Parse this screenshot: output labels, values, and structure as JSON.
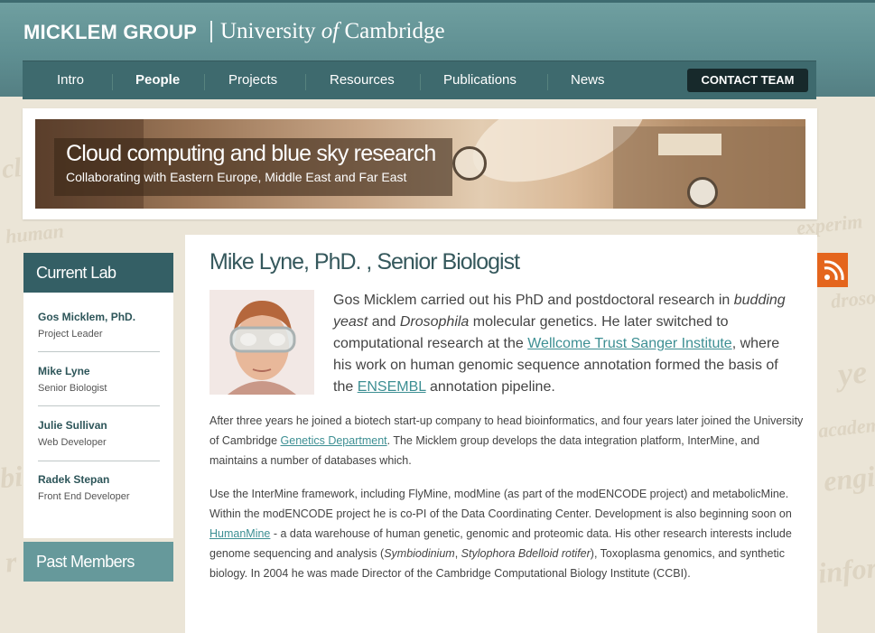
{
  "header": {
    "brand_group": "MICKLEM GROUP",
    "brand_uni_pre": "University ",
    "brand_uni_of": "of",
    "brand_uni_post": " Cambridge"
  },
  "nav": {
    "items": [
      "Intro",
      "People",
      "Projects",
      "Resources",
      "Publications",
      "News"
    ],
    "active": "People",
    "contact": "CONTACT TEAM"
  },
  "banner": {
    "title": "Cloud computing and blue sky research",
    "subtitle": "Collaborating with Eastern Europe, Middle East and Far East"
  },
  "sidebar": {
    "current_title": "Current Lab",
    "members": [
      {
        "name": "Gos Micklem, PhD.",
        "role": "Project Leader"
      },
      {
        "name": "Mike Lyne",
        "role": "Senior Biologist"
      },
      {
        "name": "Julie Sullivan",
        "role": "Web Developer"
      },
      {
        "name": "Radek Stepan",
        "role": "Front End Developer"
      }
    ],
    "past_title": "Past Members"
  },
  "content": {
    "title": "Mike Lyne, PhD. , Senior Biologist",
    "intro": {
      "t1": "Gos Micklem carried out his PhD and postdoctoral research in ",
      "em1": "budding yeast",
      "t2": " and ",
      "em2": "Drosophila",
      "t3": " molecular genetics. He later switched to computational research at the ",
      "link1": "Wellcome Trust Sanger Institute",
      "t4": ", where his work on human genomic sequence annotation formed the basis of the ",
      "link2": "ENSEMBL",
      "t5": " annotation pipeline."
    },
    "para1": {
      "t1": "After three years he joined a biotech start-up company to head bioinformatics, and four years later joined the University of Cambridge ",
      "link": "Genetics Department",
      "t2": ". The Micklem group develops the data integration platform, InterMine, and maintains a number of databases which."
    },
    "para2": {
      "t1": "Use the InterMine framework, including FlyMine, modMine (as part of the modENCODE project) and metabolicMine. Within the modENCODE project he is co-PI of the Data Coordinating Center. Development is also beginning soon on ",
      "link": "HumanMine",
      "t2": " - a data warehouse of human genetic, genomic and proteomic data. His other research interests include genome sequencing and analysis (",
      "em1": "Symbiodinium",
      "t3": ", ",
      "em2": "Stylophora Bdelloid rotifer",
      "t4": "), Toxoplasma genomics, and synthetic biology. In 2004 he was made Director of the Cambridge Computational Biology Institute (CCBI)."
    }
  },
  "background_words": [
    "human",
    "experim",
    "drosop",
    "ye",
    "academia",
    "engi",
    "bi",
    "inform",
    "r",
    "cl"
  ],
  "colors": {
    "header": "#5f8f92",
    "nav": "#3e6a6e",
    "sidebar_head": "#345f65",
    "past_head": "#66999b",
    "link": "#3d8f93",
    "rss": "#e4651d"
  },
  "icons": [
    "rss-icon"
  ]
}
